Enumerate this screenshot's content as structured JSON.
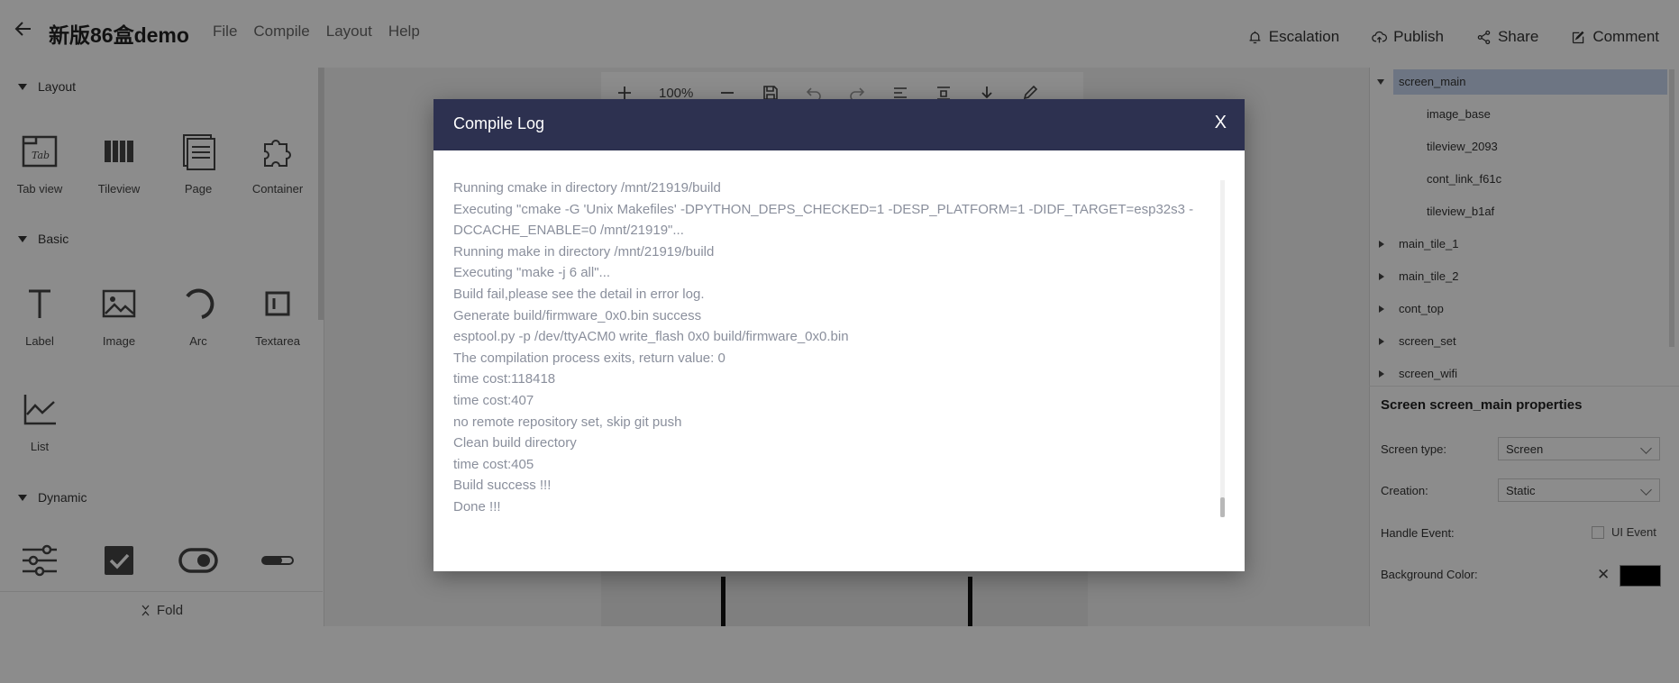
{
  "header": {
    "title": "新版86盒demo",
    "menu": [
      "File",
      "Compile",
      "Layout",
      "Help"
    ],
    "actions": [
      {
        "label": "Escalation",
        "icon": "bell-icon"
      },
      {
        "label": "Publish",
        "icon": "cloud-upload-icon"
      },
      {
        "label": "Share",
        "icon": "share-icon"
      },
      {
        "label": "Comment",
        "icon": "edit-icon"
      }
    ]
  },
  "left_panel": {
    "sections": [
      {
        "title": "Layout",
        "items": [
          "Tab view",
          "Tileview",
          "Page",
          "Container"
        ]
      },
      {
        "title": "Basic",
        "items": [
          "Label",
          "Image",
          "Arc",
          "Textarea",
          "List"
        ]
      },
      {
        "title": "Dynamic",
        "items": [
          "slider-group-icon",
          "checkbox-icon",
          "switch-icon",
          "bar-icon"
        ]
      }
    ],
    "fold_label": "Fold"
  },
  "toolbar": {
    "zoom": "100%"
  },
  "right_panel": {
    "tree": {
      "root": "screen_main",
      "children": [
        "image_base",
        "tileview_2093",
        "cont_link_f61c",
        "tileview_b1af"
      ],
      "siblings": [
        "main_tile_1",
        "main_tile_2",
        "cont_top",
        "screen_set",
        "screen_wifi"
      ]
    },
    "props": {
      "title": "Screen screen_main properties",
      "screen_type_label": "Screen type:",
      "screen_type_value": "Screen",
      "creation_label": "Creation:",
      "creation_value": "Static",
      "handle_event_label": "Handle Event:",
      "ui_event_label": "UI Event",
      "bg_color_label": "Background Color:",
      "bg_color": "#000000"
    }
  },
  "modal": {
    "title": "Compile Log",
    "close": "X",
    "lines": [
      "Running cmake in directory /mnt/21919/build",
      "Executing \"cmake -G 'Unix Makefiles' -DPYTHON_DEPS_CHECKED=1 -DESP_PLATFORM=1 -DIDF_TARGET=esp32s3 -",
      "DCCACHE_ENABLE=0 /mnt/21919\"...",
      "Running make in directory /mnt/21919/build",
      "Executing \"make -j 6 all\"...",
      "Build fail,please see the detail in error log.",
      "Generate build/firmware_0x0.bin success",
      "esptool.py -p /dev/ttyACM0 write_flash 0x0 build/firmware_0x0.bin",
      "The compilation process exits, return value: 0",
      "time cost:118418",
      "time cost:407",
      "no remote repository set, skip git push",
      "Clean build directory",
      "time cost:405",
      "Build success !!!",
      "Done !!!"
    ]
  },
  "colors": {
    "modal_header": "#2d3150",
    "log_text": "#8a8f9c",
    "selected_row": "#c7d6ee"
  }
}
